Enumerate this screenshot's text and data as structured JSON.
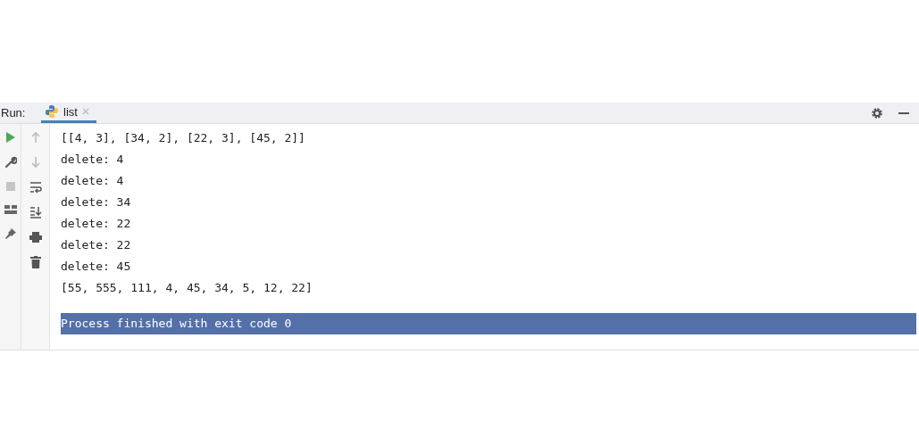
{
  "run_panel": {
    "label": "Run:",
    "tabs": [
      {
        "label": "list",
        "selected": true
      }
    ],
    "console": {
      "lines": [
        {
          "kind": "output",
          "text": "[[4, 3], [34, 2], [22, 3], [45, 2]]",
          "selected": false
        },
        {
          "kind": "output",
          "text": "delete: 4",
          "selected": false
        },
        {
          "kind": "output",
          "text": "delete: 4",
          "selected": false
        },
        {
          "kind": "output",
          "text": "delete: 34",
          "selected": false
        },
        {
          "kind": "output",
          "text": "delete: 22",
          "selected": false
        },
        {
          "kind": "output",
          "text": "delete: 22",
          "selected": false
        },
        {
          "kind": "output",
          "text": "delete: 45",
          "selected": false
        },
        {
          "kind": "output",
          "text": "[55, 555, 111, 4, 45, 34, 5, 12, 22]",
          "selected": false
        },
        {
          "kind": "exit",
          "text": "Process finished with exit code 0",
          "selected": true
        }
      ]
    }
  }
}
